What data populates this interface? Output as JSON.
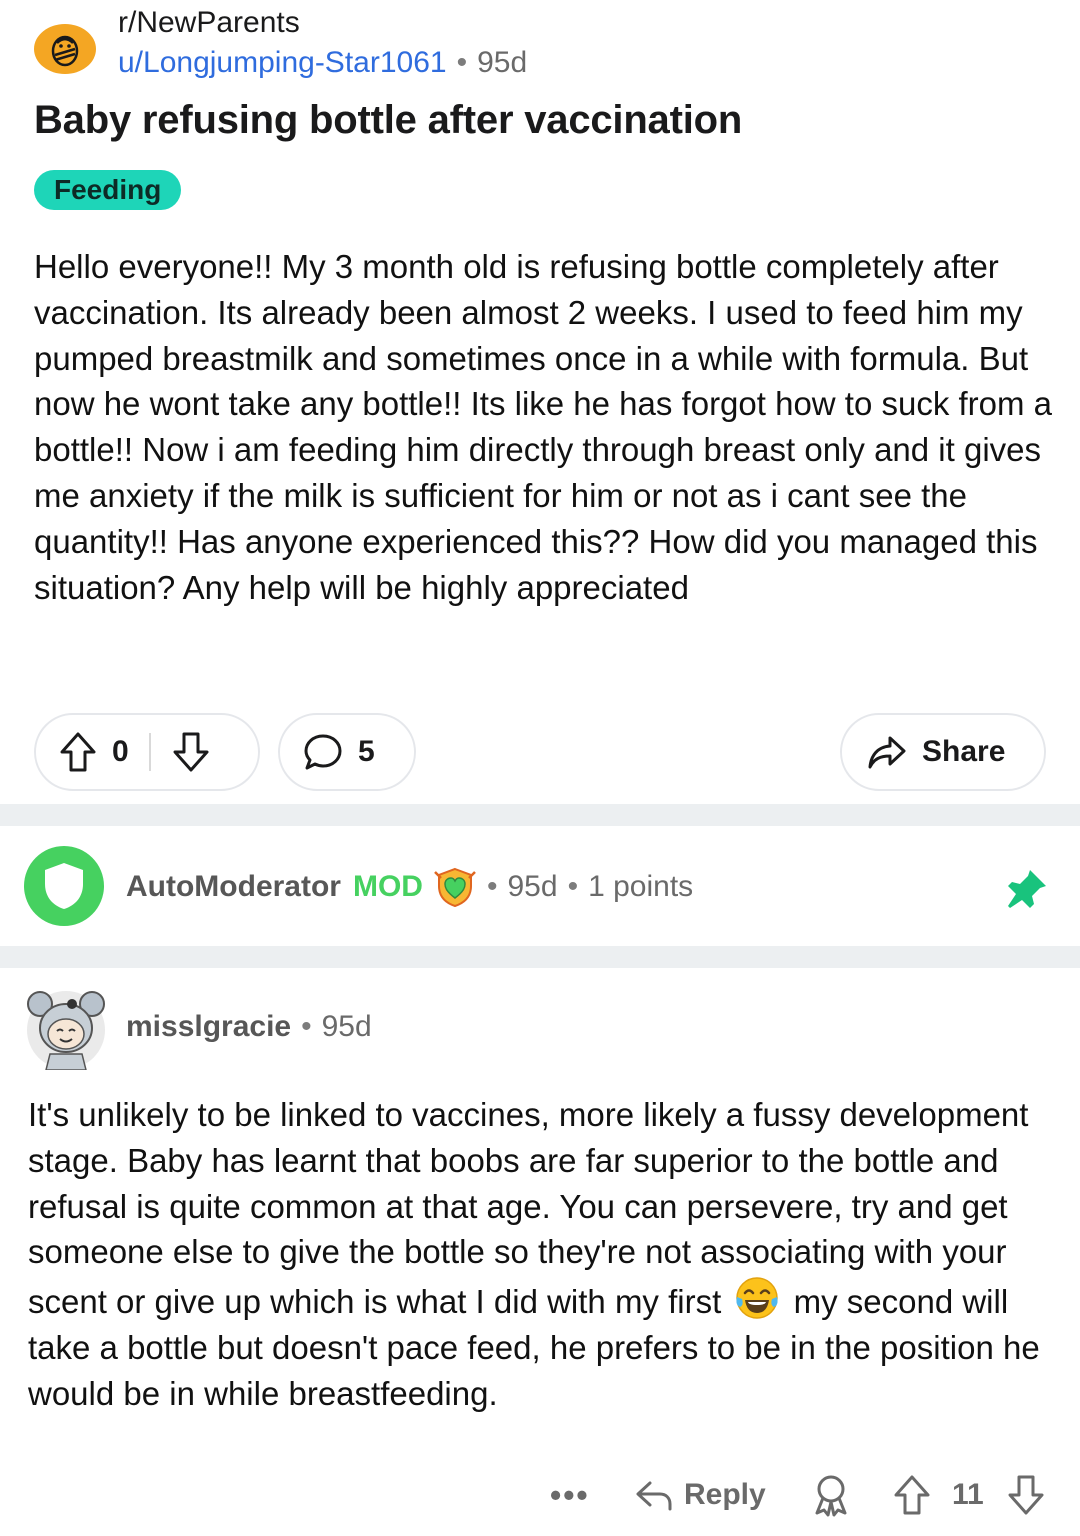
{
  "post": {
    "subreddit": "r/NewParents",
    "subreddit_icon": "snoo-baby-icon",
    "author": "u/Longjumping-Star1061",
    "separator": "•",
    "age": "95d",
    "title": "Baby refusing bottle after vaccination",
    "flair": "Feeding",
    "body": "Hello everyone!! My 3 month old is refusing bottle completely after vaccination. Its already been almost 2 weeks. I used to feed him my pumped breastmilk and sometimes once in a while with formula. But now he wont take any bottle!! Its like he has forgot how to suck from a bottle!! Now i am feeding him directly through breast only and it gives me anxiety if the milk is sufficient for him or not as i cant see the quantity!! Has anyone experienced this?? How did you managed this situation? Any help will be highly appreciated",
    "votes": "0",
    "comments": "5",
    "share_label": "Share"
  },
  "automod": {
    "name": "AutoModerator",
    "tag": "MOD",
    "separator": "•",
    "age": "95d",
    "points": "1 points"
  },
  "comment": {
    "author": "misslgracie",
    "separator": "•",
    "age": "95d",
    "body_part1": "It's unlikely to be linked to vaccines, more likely a fussy development stage. Baby has learnt that boobs are far superior to the bottle and refusal is quite common at that age. You can persevere, try and get someone else to give the bottle so they're not associating with your scent or give up which is what I did with my first",
    "body_part2": "my second will take a bottle but doesn't pace feed, he prefers to be in the position he would be in while breastfeeding.",
    "emoji": "tears-of-joy-emoji",
    "more_label": "•••",
    "reply_label": "Reply",
    "votes": "11"
  },
  "colors": {
    "accent_blue": "#2f6cde",
    "flair_bg": "#1ed5b8",
    "mod_green": "#46d160",
    "subreddit_icon_bg": "#f4a623"
  }
}
